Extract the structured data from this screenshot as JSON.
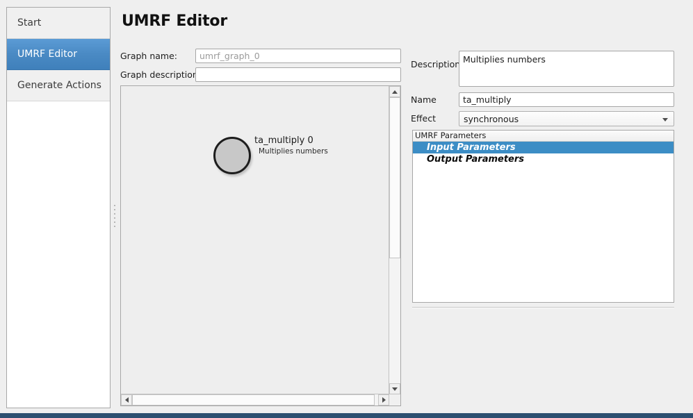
{
  "window": {
    "accent_color": "#3f80bb",
    "selection_color": "#3c8dc5",
    "bottom_bar_color": "#2d4f70",
    "background_color": "#efefef"
  },
  "sidebar": {
    "items": [
      {
        "label": "Start",
        "selected": false
      },
      {
        "label": "UMRF Editor",
        "selected": true
      },
      {
        "label": "Generate Actions",
        "selected": false
      }
    ]
  },
  "main": {
    "title": "UMRF Editor",
    "form": {
      "graph_name_label": "Graph name:",
      "graph_name_value": "",
      "graph_name_placeholder": "umrf_graph_0",
      "graph_description_label": "Graph description:",
      "graph_description_value": "",
      "graph_description_placeholder": ""
    },
    "graph": {
      "node": {
        "title": "ta_multiply 0",
        "subtitle": "Multiplies numbers",
        "fill_color": "#c8c8c8",
        "border_color": "#1d1d1d"
      },
      "scrollbars": {
        "vertical_up_icon": "triangle-up-icon",
        "vertical_down_icon": "triangle-down-icon",
        "horizontal_left_icon": "triangle-left-icon",
        "horizontal_right_icon": "triangle-right-icon"
      }
    }
  },
  "right_panel": {
    "description_label": "Description",
    "description_value": "Multiplies numbers",
    "name_label": "Name",
    "name_value": "ta_multiply",
    "effect_label": "Effect",
    "effect_value": "synchronous",
    "effect_options": [
      "synchronous"
    ],
    "effect_arrow_icon": "chevron-down-icon",
    "tree": {
      "header": "UMRF Parameters",
      "rows": [
        {
          "label": "Input Parameters",
          "selected": true
        },
        {
          "label": "Output Parameters",
          "selected": false
        }
      ]
    }
  }
}
